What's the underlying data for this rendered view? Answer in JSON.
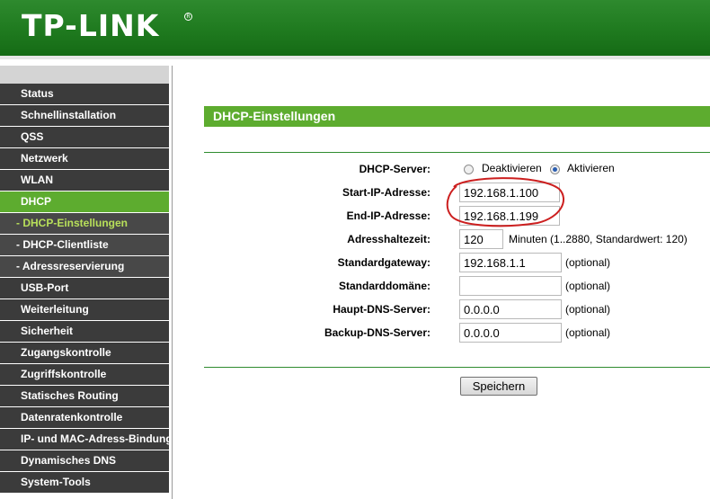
{
  "header": {
    "logo": "TP-LINK",
    "reg_mark": "R"
  },
  "sidebar": {
    "items": [
      {
        "label": "Status",
        "type": "main"
      },
      {
        "label": "Schnellinstallation",
        "type": "main"
      },
      {
        "label": "QSS",
        "type": "main"
      },
      {
        "label": "Netzwerk",
        "type": "main"
      },
      {
        "label": "WLAN",
        "type": "main"
      },
      {
        "label": "DHCP",
        "type": "active"
      },
      {
        "label": "- DHCP-Einstellungen",
        "type": "sub-current"
      },
      {
        "label": "- DHCP-Clientliste",
        "type": "sub"
      },
      {
        "label": "- Adressreservierung",
        "type": "sub"
      },
      {
        "label": "USB-Port",
        "type": "main"
      },
      {
        "label": "Weiterleitung",
        "type": "main"
      },
      {
        "label": "Sicherheit",
        "type": "main"
      },
      {
        "label": "Zugangskontrolle",
        "type": "main"
      },
      {
        "label": "Zugriffskontrolle",
        "type": "main"
      },
      {
        "label": "Statisches Routing",
        "type": "main"
      },
      {
        "label": "Datenratenkontrolle",
        "type": "main"
      },
      {
        "label": "IP- und MAC-Adress-Bindung",
        "type": "main"
      },
      {
        "label": "Dynamisches DNS",
        "type": "main"
      },
      {
        "label": "System-Tools",
        "type": "main"
      }
    ]
  },
  "main": {
    "title": "DHCP-Einstellungen",
    "dhcp_server": {
      "label": "DHCP-Server:",
      "option_off": "Deaktivieren",
      "option_on": "Aktivieren",
      "selected": "Aktivieren"
    },
    "start_ip": {
      "label": "Start-IP-Adresse:",
      "value": "192.168.1.100"
    },
    "end_ip": {
      "label": "End-IP-Adresse:",
      "value": "192.168.1.199"
    },
    "lease_time": {
      "label": "Adresshaltezeit:",
      "value": "120",
      "note": "Minuten (1..2880, Standardwert: 120)"
    },
    "gateway": {
      "label": "Standardgateway:",
      "value": "192.168.1.1",
      "note": "(optional)"
    },
    "domain": {
      "label": "Standarddomäne:",
      "value": "",
      "note": "(optional)"
    },
    "primary_dns": {
      "label": "Haupt-DNS-Server:",
      "value": "0.0.0.0",
      "note": "(optional)"
    },
    "secondary_dns": {
      "label": "Backup-DNS-Server:",
      "value": "0.0.0.0",
      "note": "(optional)"
    },
    "save_label": "Speichern"
  },
  "colors": {
    "header_green": "#1f7a1f",
    "accent_green": "#5dac2f",
    "menu_dark": "#3b3b3b",
    "sub_current_text": "#b8e05a",
    "annotation_red": "#cc1f1f"
  }
}
